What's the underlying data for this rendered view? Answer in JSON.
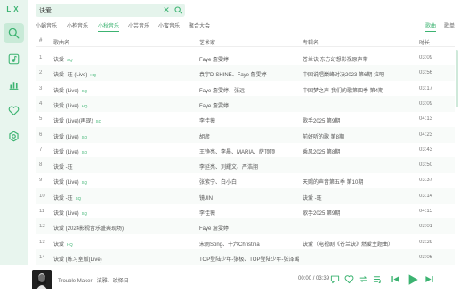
{
  "app": {
    "logo": "LX"
  },
  "colors": {
    "accent": "#3cb371",
    "sidebar_bg": "#e8f5ee",
    "search_bg": "#e5f4ec"
  },
  "sidebar": {
    "items": [
      {
        "icon": "search-icon",
        "active": true
      },
      {
        "icon": "music-note-icon",
        "active": false
      },
      {
        "icon": "bar-chart-icon",
        "active": false
      },
      {
        "icon": "heart-icon",
        "active": false
      },
      {
        "icon": "settings-icon",
        "active": false
      }
    ]
  },
  "search": {
    "value": "诀爱",
    "placeholder": ""
  },
  "source_tabs": [
    "小蜗音乐",
    "小枸音乐",
    "小秋音乐",
    "小芸音乐",
    "小蜜音乐",
    "聚合大会"
  ],
  "source_tab_active": 2,
  "type_tabs": [
    "歌曲",
    "歌单"
  ],
  "type_tab_active": 0,
  "table": {
    "headers": {
      "idx": "#",
      "name": "歌曲名",
      "artist": "艺术家",
      "album": "专辑名",
      "duration": "时长"
    },
    "rows": [
      {
        "idx": "1",
        "name": "诀爱",
        "tag": "SQ",
        "artist": "Faye 詹雯婷",
        "album": "苍兰诀 东方幻想影视原声带",
        "duration": "03:09"
      },
      {
        "idx": "2",
        "name": "诀爱 -珏 (Live)",
        "tag": "HQ",
        "artist": "袁宇D-SHINE、Faye 詹雯婷",
        "album": "中国说唱巅峰对决2023 第6期 拉吧",
        "duration": "03:56"
      },
      {
        "idx": "3",
        "name": "诀爱 (Live)",
        "tag": "SQ",
        "artist": "Faye 詹雯婷、张远",
        "album": "中国梦之声·我们的歌第四季 第4期",
        "duration": "03:17"
      },
      {
        "idx": "4",
        "name": "诀爱 (Live)",
        "tag": "HQ",
        "artist": "Faye 詹雯婷",
        "album": "",
        "duration": "03:09"
      },
      {
        "idx": "5",
        "name": "诀爱 (Live)(再现)",
        "tag": "SQ",
        "artist": "李佳薇",
        "album": "歌手2025 第9期",
        "duration": "04:13"
      },
      {
        "idx": "6",
        "name": "诀爱 (Live)",
        "tag": "SQ",
        "artist": "胡彦",
        "album": "前好听的歌 第8期",
        "duration": "04:23"
      },
      {
        "idx": "7",
        "name": "诀爱 (Live)",
        "tag": "SQ",
        "artist": "王铮亮、李晨、MARIA、萨顶顶",
        "album": "乘风2025 第8期",
        "duration": "03:43"
      },
      {
        "idx": "8",
        "name": "诀爱 -珏",
        "tag": "",
        "artist": "李延亮、刘耀文、严浩翔",
        "album": "",
        "duration": "03:50"
      },
      {
        "idx": "9",
        "name": "诀爱 (Live)",
        "tag": "SQ",
        "artist": "张紫宁、白小白",
        "album": "天赐的声音第五季 第10期",
        "duration": "03:37"
      },
      {
        "idx": "10",
        "name": "诀爱 -珏",
        "tag": "SQ",
        "artist": "镜JIN",
        "album": "诀爱 -珏",
        "duration": "03:14"
      },
      {
        "idx": "11",
        "name": "诀爱 (Live)",
        "tag": "SQ",
        "artist": "李佳薇",
        "album": "歌手2025 第9期",
        "duration": "04:15"
      },
      {
        "idx": "12",
        "name": "诀爱 (2024影视音乐盛典现场)",
        "tag": "",
        "artist": "Faye 詹雯婷",
        "album": "",
        "duration": "03:01"
      },
      {
        "idx": "13",
        "name": "诀爱",
        "tag": "HQ",
        "artist": "宋雨Song、十六Christina",
        "album": "诀爱（电视剧《苍兰诀》燃爱主题曲）",
        "duration": "03:29"
      },
      {
        "idx": "14",
        "name": "诀爱 (练习室版(Live)",
        "tag": "",
        "artist": "TOP登陆少年-张极、TOP登陆少年-张泽禹",
        "album": "",
        "duration": "03:06"
      }
    ]
  },
  "player": {
    "track": "Trouble Maker - 泫雅、玟怿日",
    "current_time": "00:00",
    "separator": "/",
    "total_time": "03:39",
    "controls": [
      "comment-icon",
      "heart-icon",
      "repeat-icon",
      "playlist-icon",
      "prev-icon",
      "play-icon",
      "next-icon"
    ]
  }
}
